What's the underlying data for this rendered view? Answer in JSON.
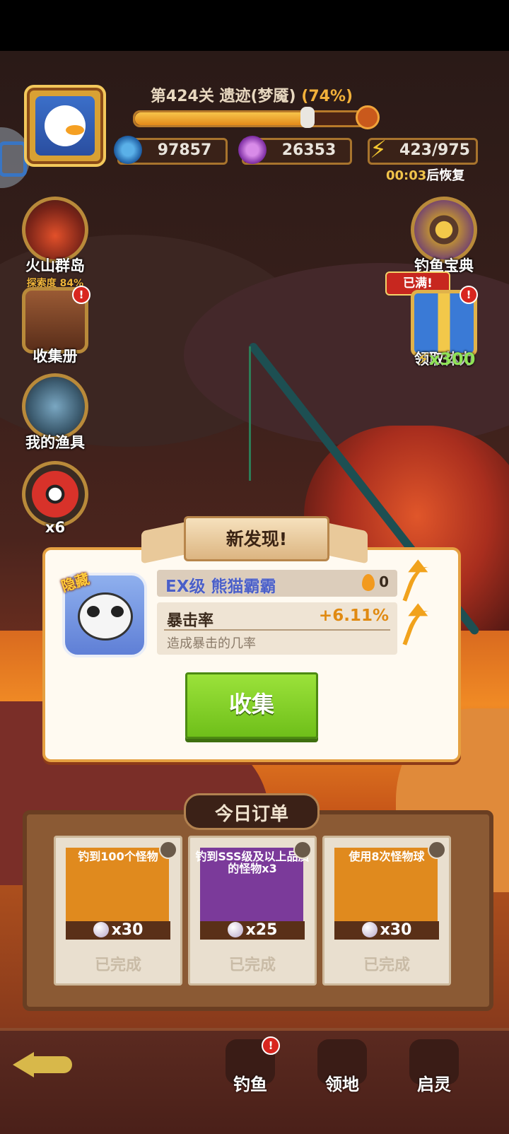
{
  "hud": {
    "level_text": "第424关 遗迹(梦魇)",
    "level_progress_text": "(74%)",
    "level_progress": 0.74,
    "coins": "97857",
    "gems": "26353",
    "energy": "423/975",
    "recover_time": "00:03",
    "recover_suffix": "后恢复"
  },
  "left_menu": {
    "island_label": "火山群岛",
    "island_sub": "探索度 84%",
    "album_label": "收集册",
    "gear_label": "我的渔具",
    "ball_count": "x6"
  },
  "right_menu": {
    "guide_label": "钓鱼宝典",
    "full_tag": "已满!",
    "energy_label": "领取体力",
    "energy_reward": "x300"
  },
  "popup": {
    "ribbon": "新发现!",
    "hidden_tag": "隐藏",
    "monster_name": "EX级 熊猫霸霸",
    "flame_value": "0",
    "stat_name": "暴击率",
    "stat_value": "+6.11%",
    "stat_desc": "造成暴击的几率",
    "collect_button": "收集"
  },
  "orders": {
    "title": "今日订单",
    "items": [
      {
        "task": "钓到100个怪物",
        "reward": "x30",
        "status": "已完成",
        "color": "#e08a1e"
      },
      {
        "task": "钓到SSS级及以上品质的怪物x3",
        "reward": "x25",
        "status": "已完成",
        "color": "#7b3a9a"
      },
      {
        "task": "使用8次怪物球",
        "reward": "x30",
        "status": "已完成",
        "color": "#e08a1e"
      }
    ]
  },
  "nav": {
    "fish": "钓鱼",
    "territory": "领地",
    "spirit": "启灵"
  },
  "icons": {
    "coin": "coin-icon",
    "gem": "gem-icon",
    "energy": "lightning-icon"
  }
}
